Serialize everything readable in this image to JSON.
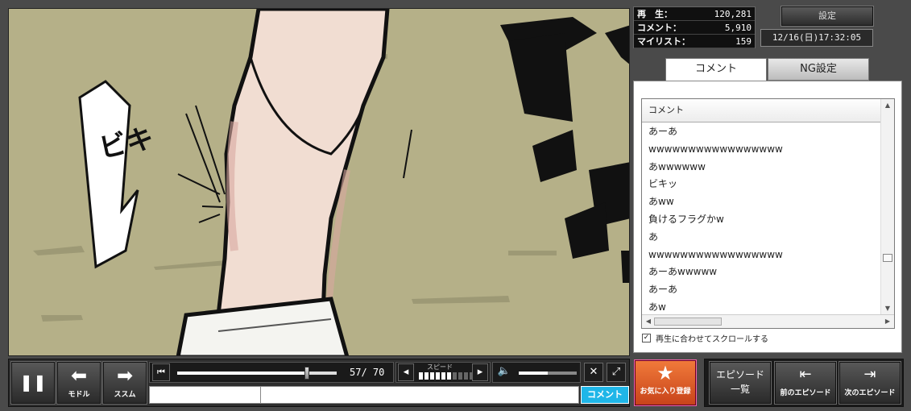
{
  "stats": {
    "views_label": "再　生：",
    "views_value": "120,281",
    "comments_label": "コメント：",
    "comments_value": "5,910",
    "mylist_label": "マイリスト：",
    "mylist_value": "159"
  },
  "header": {
    "settings_label": "設定",
    "datetime": "12/16(日)17:32:05"
  },
  "tabs": {
    "comment": "コメント",
    "ng": "NG設定"
  },
  "comment_list": {
    "column_header": "コメント",
    "rows": [
      "あーあ",
      "wwwwwwwwwwwwwwwww",
      "あwwwwww",
      "ビキッ",
      "あww",
      "負けるフラグかw",
      "あ",
      "wwwwwwwwwwwwwwwww",
      "あーあwwwww",
      "あーあ",
      "あw"
    ],
    "scroll_up": "▲",
    "scroll_down": "▼",
    "scroll_left": "◀",
    "scroll_right": "▶",
    "sync_label": "再生に合わせてスクロールする",
    "sync_checked": "✓"
  },
  "controls": {
    "pause_icon": "❚❚",
    "back_icon": "⬅",
    "back_label": "モドル",
    "forward_icon": "➡",
    "forward_label": "ススム",
    "skip_start_icon": "⏮",
    "seek_current": "57",
    "seek_total": "70",
    "seek_time": "57/ 70",
    "speed_label": "スピード",
    "speed_down": "◂",
    "speed_up": "▸",
    "speed_level": 6,
    "speed_max": 10,
    "volume_icon": "🔈",
    "volume_fraction": 0.5,
    "comment_toggle_icon": "✕",
    "fullscreen_icon": "⤢",
    "comment_submit_label": "コメント"
  },
  "side_buttons": {
    "favorite_icon": "★",
    "favorite_label": "お気に入り登録",
    "episode_list_line1": "エピソード",
    "episode_list_line2": "一覧",
    "prev_icon": "⇤",
    "prev_label": "前のエピソード",
    "next_icon": "⇥",
    "next_label": "次のエピソード"
  },
  "video": {
    "sfx_text": "ビキ"
  },
  "colors": {
    "submit_accent": "#1fb6e8",
    "favorite_accent": "#e0602a",
    "video_bg": "#b7b28a"
  }
}
